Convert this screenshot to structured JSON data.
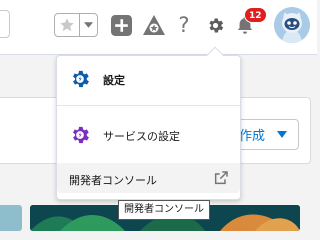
{
  "header": {
    "badge_count": "12",
    "help_symbol": "?"
  },
  "setup_menu": {
    "items": [
      {
        "label": "設定",
        "icon": "gear-icon"
      },
      {
        "label": "サービスの設定",
        "icon": "service-gear-icon"
      },
      {
        "label": "開発者コンソール",
        "icon": "external-link-icon"
      }
    ]
  },
  "tooltip": {
    "text": "開発者コンソール"
  },
  "background": {
    "create_button_label": "作成"
  },
  "colors": {
    "setup_gear": "#0b5cab",
    "service_gear": "#7b2ec4",
    "badge": "#e01e1e",
    "link_blue": "#0176d3",
    "avatar_bg": "#aacbe8"
  }
}
